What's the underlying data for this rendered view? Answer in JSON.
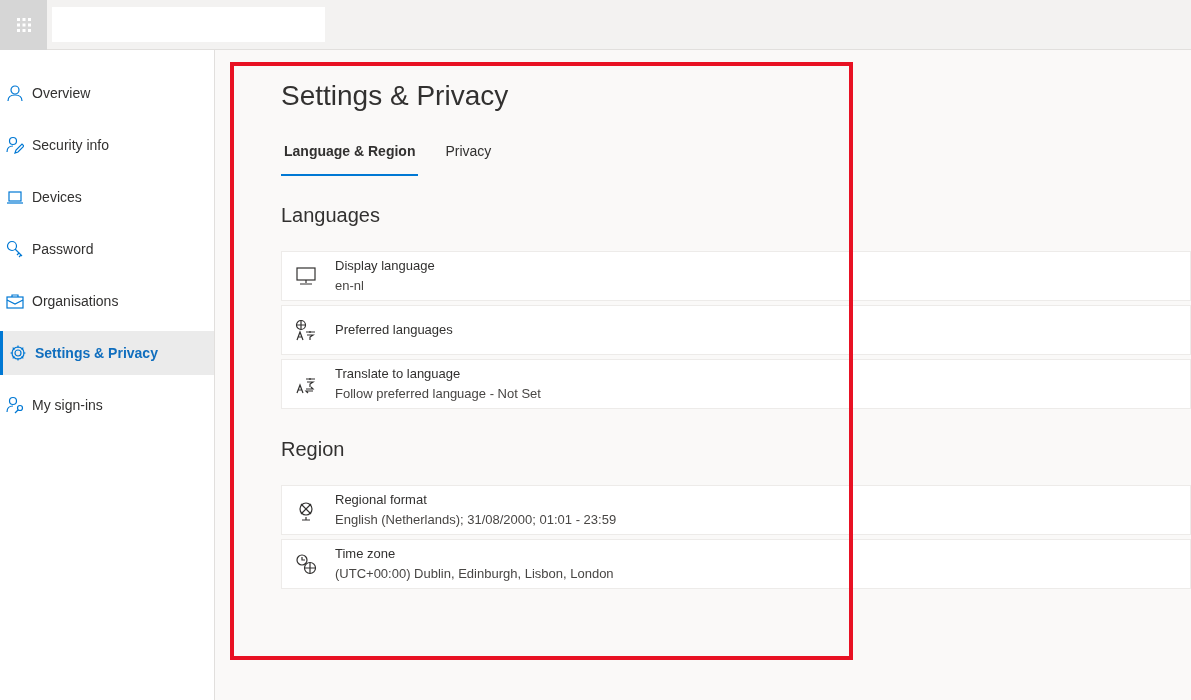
{
  "sidebar": {
    "items": [
      {
        "label": "Overview",
        "selected": false
      },
      {
        "label": "Security info",
        "selected": false
      },
      {
        "label": "Devices",
        "selected": false
      },
      {
        "label": "Password",
        "selected": false
      },
      {
        "label": "Organisations",
        "selected": false
      },
      {
        "label": "Settings & Privacy",
        "selected": true
      },
      {
        "label": "My sign-ins",
        "selected": false
      }
    ]
  },
  "page": {
    "title": "Settings & Privacy",
    "tabs": [
      {
        "label": "Language & Region",
        "selected": true
      },
      {
        "label": "Privacy",
        "selected": false
      }
    ],
    "sections": [
      {
        "heading": "Languages",
        "rows": [
          {
            "title": "Display language",
            "value": "en-nl"
          },
          {
            "title": "Preferred languages"
          },
          {
            "title": "Translate to language",
            "value": "Follow preferred language - Not Set"
          }
        ]
      },
      {
        "heading": "Region",
        "rows": [
          {
            "title": "Regional format",
            "value": "English (Netherlands); 31/08/2000; 01:01 - 23:59"
          },
          {
            "title": "Time zone",
            "value": "(UTC+00:00) Dublin, Edinburgh, Lisbon, London"
          }
        ]
      }
    ]
  }
}
